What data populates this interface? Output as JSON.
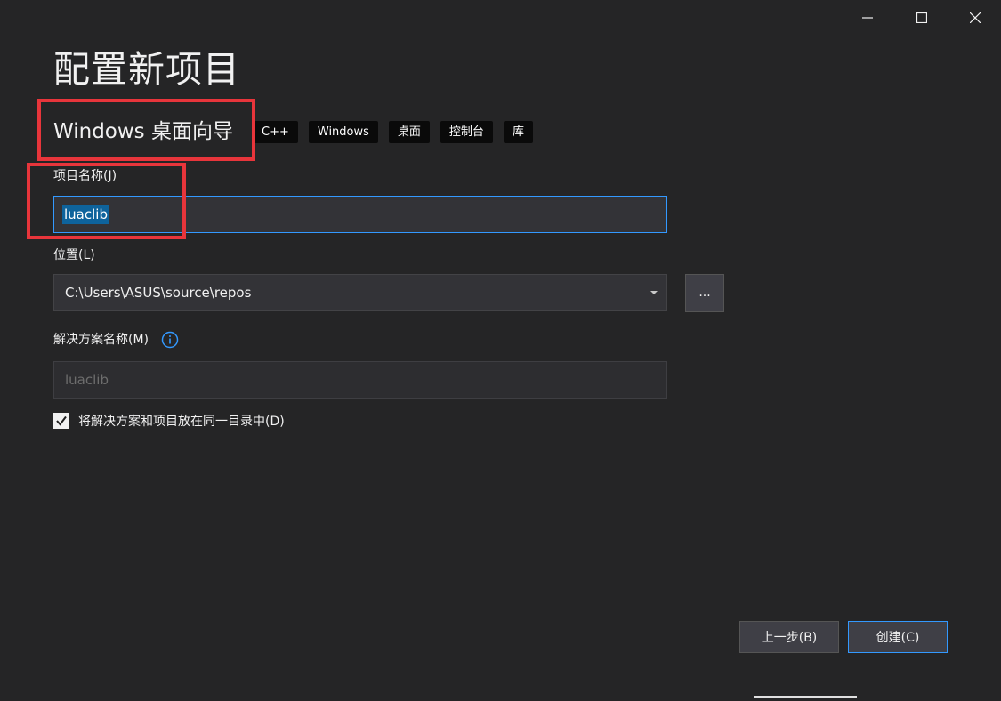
{
  "title": "配置新项目",
  "template": {
    "name": "Windows 桌面向导",
    "tags": [
      "C++",
      "Windows",
      "桌面",
      "控制台",
      "库"
    ]
  },
  "project_name": {
    "label": "项目名称(J)",
    "value": "luaclib"
  },
  "location": {
    "label": "位置(L)",
    "value": "C:\\Users\\ASUS\\source\\repos",
    "browse_label": "..."
  },
  "solution_name": {
    "label": "解决方案名称(M)",
    "placeholder": "luaclib",
    "info_icon": "info-icon"
  },
  "same_dir": {
    "label": "将解决方案和项目放在同一目录中(D)",
    "checked": true
  },
  "buttons": {
    "back": "上一步(B)",
    "create": "创建(C)"
  },
  "colors": {
    "background": "#252526",
    "accent": "#3399ff",
    "highlight": "#e8353b"
  }
}
